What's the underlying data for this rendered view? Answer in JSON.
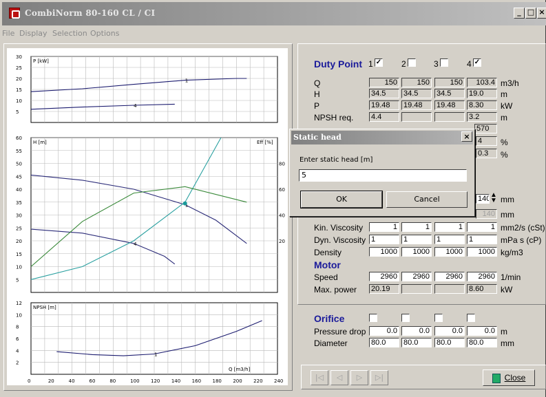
{
  "window": {
    "title": "CombiNorm 80-160  CL / CI"
  },
  "menu": [
    "File",
    "Display",
    "Selection",
    "Options"
  ],
  "charts": {
    "power": {
      "ylabel": "P [kW]",
      "yticks": [
        "30",
        "25",
        "20",
        "15",
        "10",
        "5"
      ],
      "curve_labels": [
        "1",
        "4"
      ]
    },
    "head": {
      "ylabel": "H [m]",
      "ylabel_right": "Eff [%]",
      "yticks": [
        "60",
        "55",
        "50",
        "45",
        "40",
        "35",
        "30",
        "25",
        "20",
        "15",
        "10",
        "5"
      ],
      "yticks_right": [
        "80",
        "60",
        "40",
        "20"
      ],
      "curve_labels": [
        "1",
        "4",
        "1"
      ]
    },
    "npsh": {
      "ylabel": "NPSH [m]",
      "yticks": [
        "12",
        "10",
        "8",
        "6",
        "4",
        "2"
      ],
      "xlabel": "Q [m3/h]",
      "xticks": [
        "0",
        "20",
        "40",
        "60",
        "80",
        "100",
        "120",
        "140",
        "160",
        "180",
        "200",
        "220",
        "240"
      ],
      "curve_labels": [
        "1"
      ]
    }
  },
  "chart_data": {
    "type": "line",
    "x_unit": "Q [m3/h]",
    "xlim": [
      0,
      240
    ],
    "series": [
      {
        "name": "1",
        "panel": "P [kW]",
        "x": [
          0,
          50,
          100,
          150,
          200,
          210
        ],
        "y": [
          14.0,
          15.3,
          17.3,
          19.2,
          20.0,
          20.0
        ]
      },
      {
        "name": "4",
        "panel": "P [kW]",
        "x": [
          0,
          50,
          100,
          140
        ],
        "y": [
          6.0,
          7.0,
          7.8,
          8.3
        ]
      },
      {
        "name": "1",
        "panel": "H [m]",
        "x": [
          0,
          50,
          100,
          150,
          180,
          210
        ],
        "y": [
          45.5,
          43.5,
          40.0,
          34.0,
          28.0,
          19.0
        ]
      },
      {
        "name": "4",
        "panel": "H [m]",
        "x": [
          0,
          50,
          100,
          130,
          140
        ],
        "y": [
          24.5,
          23.0,
          19.0,
          14.0,
          11.0
        ]
      },
      {
        "name": "",
        "panel": "H [m]",
        "x": [
          0,
          50,
          100,
          150,
          185
        ],
        "y": [
          5.0,
          10.0,
          20.0,
          35.0,
          60.0
        ]
      },
      {
        "name": "",
        "panel": "Eff [%]",
        "x": [
          0,
          50,
          100,
          150,
          210
        ],
        "y": [
          0,
          35,
          57,
          62,
          50
        ]
      },
      {
        "name": "1",
        "panel": "NPSH [m]",
        "x": [
          25,
          60,
          90,
          120,
          160,
          200,
          225
        ],
        "y": [
          3.8,
          3.3,
          3.1,
          3.4,
          4.8,
          7.2,
          9.0
        ]
      }
    ],
    "duty_point": {
      "Q": 150,
      "H": 34.5
    }
  },
  "duty": {
    "title": "Duty Point",
    "columns": [
      {
        "label": "1",
        "checked": true
      },
      {
        "label": "2",
        "checked": false
      },
      {
        "label": "3",
        "checked": false
      },
      {
        "label": "4",
        "checked": true
      }
    ],
    "rows": {
      "Q": {
        "label": "Q",
        "values": [
          "150",
          "150",
          "150",
          "103.4"
        ],
        "unit": "m3/h"
      },
      "H": {
        "label": "H",
        "values": [
          "34.5",
          "34.5",
          "34.5",
          "19.0"
        ],
        "unit": "m"
      },
      "P": {
        "label": "P",
        "values": [
          "19.48",
          "19.48",
          "19.48",
          "8.30"
        ],
        "unit": "kW"
      },
      "NPSH": {
        "label": "NPSH req.",
        "values": [
          "4.4",
          "",
          "",
          "3.2"
        ],
        "unit": "m"
      }
    },
    "partial": {
      "v570": "570",
      "v4": "4",
      "pct1": "%",
      "v03": "0.3",
      "pct2": "%"
    },
    "dia": {
      "value": "140",
      "unit_top": "mm",
      "unit_bot": "mm",
      "spin_value": "140"
    }
  },
  "fluid": {
    "kin": {
      "label": "Kin. Viscosity",
      "values": [
        "1",
        "1",
        "1",
        "1"
      ],
      "unit": "mm2/s (cSt)"
    },
    "dyn": {
      "label": "Dyn. Viscosity",
      "values": [
        "1",
        "1",
        "1",
        "1"
      ],
      "unit": "mPa s (cP)"
    },
    "dens": {
      "label": "Density",
      "values": [
        "1000",
        "1000",
        "1000",
        "1000"
      ],
      "unit": "kg/m3"
    }
  },
  "motor": {
    "title": "Motor",
    "speed": {
      "label": "Speed",
      "values": [
        "2960",
        "2960",
        "2960",
        "2960"
      ],
      "unit": "1/min"
    },
    "maxp": {
      "label": "Max. power",
      "values": [
        "20.19",
        "",
        "",
        "8.60"
      ],
      "unit": "kW"
    }
  },
  "orifice": {
    "title": "Orifice",
    "pdrop": {
      "label": "Pressure drop",
      "values": [
        "0.0",
        "0.0",
        "0.0",
        "0.0"
      ],
      "unit": "m"
    },
    "diam": {
      "label": "Diameter",
      "values": [
        "80.0",
        "80.0",
        "80.0",
        "80.0"
      ],
      "unit": "mm"
    }
  },
  "nav": {
    "first": "|◁",
    "prev": "◁",
    "next": "▷",
    "last": "▷|",
    "close": "Close"
  },
  "dialog": {
    "title": "Static head",
    "prompt": "Enter static head [m]",
    "value": "5",
    "ok": "OK",
    "cancel": "Cancel"
  }
}
